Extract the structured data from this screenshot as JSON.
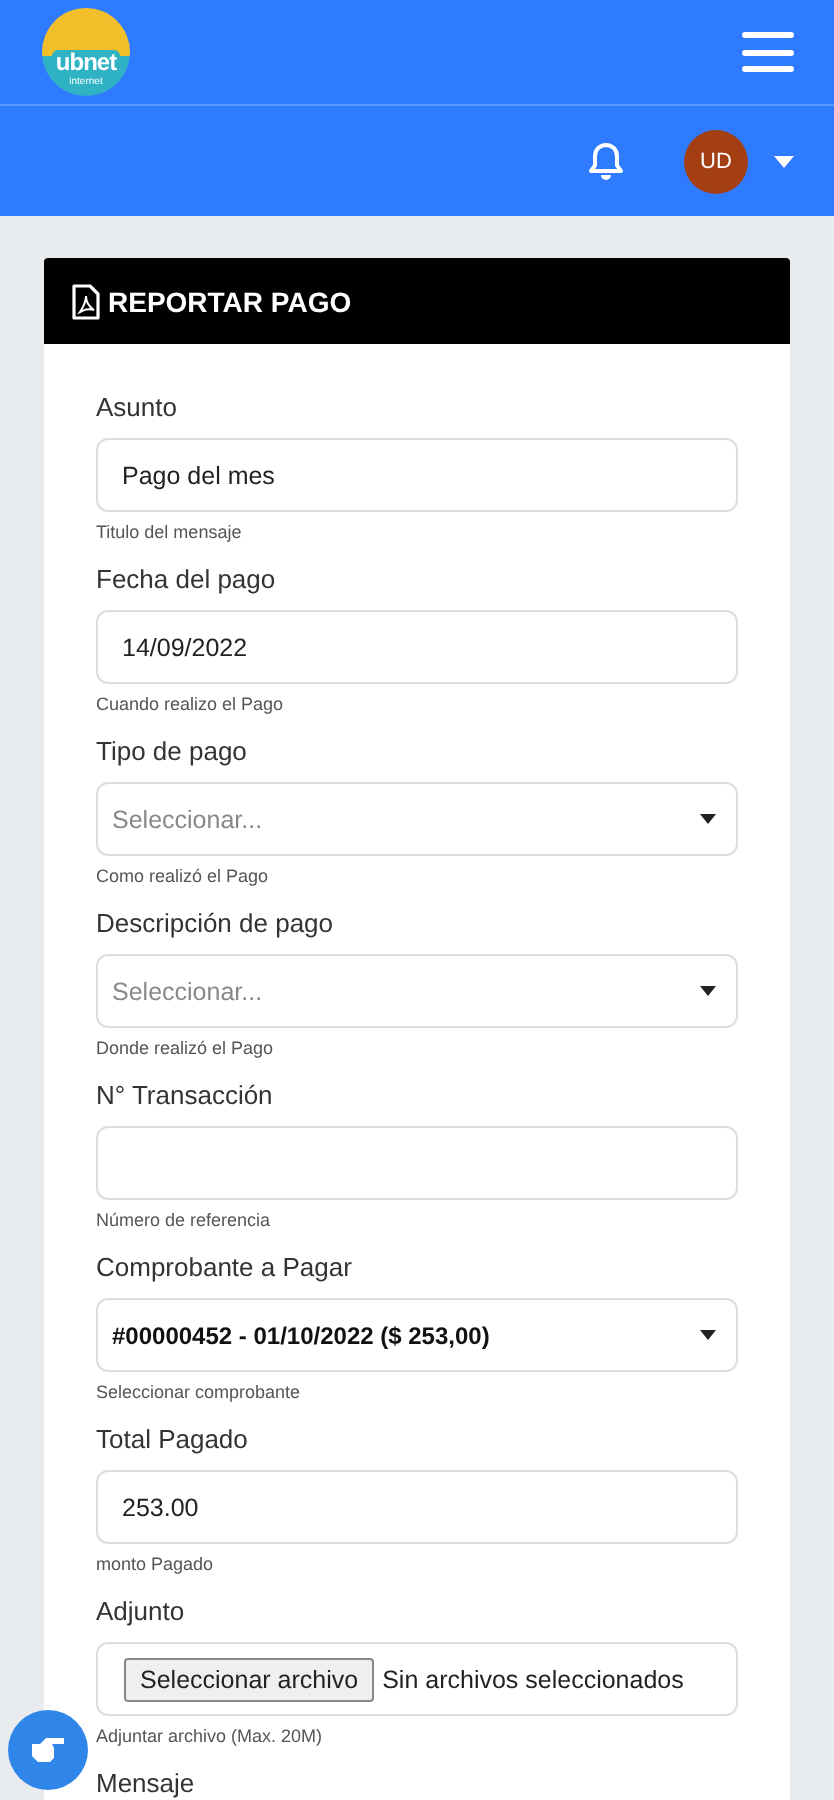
{
  "logo": {
    "title": "ubnet",
    "subtitle": "internet"
  },
  "user": {
    "initials": "UD"
  },
  "card": {
    "title": "REPORTAR PAGO"
  },
  "fields": [
    {
      "kind": "text",
      "label": "Asunto",
      "value": "Pago del mes",
      "help": "Titulo del mensaje"
    },
    {
      "kind": "text",
      "label": "Fecha del pago",
      "value": "14/09/2022",
      "help": "Cuando realizo el Pago"
    },
    {
      "kind": "select",
      "label": "Tipo de pago",
      "placeholder": "Seleccionar...",
      "help": "Como realizó el Pago"
    },
    {
      "kind": "select",
      "label": "Descripción de pago",
      "placeholder": "Seleccionar...",
      "help": "Donde realizó el Pago"
    },
    {
      "kind": "text",
      "label": "N° Transacción",
      "help": "Número de referencia"
    },
    {
      "kind": "select",
      "label": "Comprobante a Pagar",
      "value": "#00000452 - 01/10/2022 ($ 253,00)",
      "help": "Seleccionar comprobante"
    },
    {
      "kind": "text",
      "label": "Total Pagado",
      "value": "253.00",
      "help": "monto Pagado"
    },
    {
      "kind": "file",
      "label": "Adjunto",
      "button": "Seleccionar archivo",
      "value": "Sin archivos seleccionados",
      "help": "Adjuntar archivo (Max. 20M)"
    },
    {
      "kind": "label",
      "label": "Mensaje"
    }
  ]
}
